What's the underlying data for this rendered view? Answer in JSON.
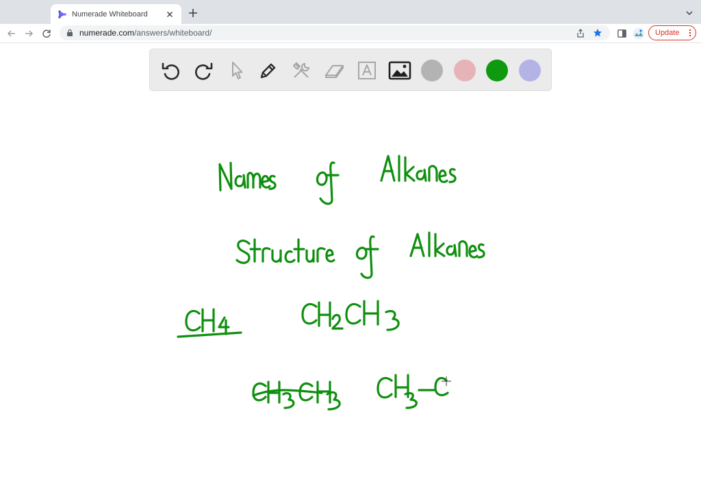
{
  "browser": {
    "tab_title": "Numerade Whiteboard",
    "url_host": "numerade.com",
    "url_path": "/answers/whiteboard/",
    "update_label": "Update"
  },
  "toolbar": {
    "tools": [
      "undo-icon",
      "redo-icon",
      "pointer-icon",
      "pen-icon",
      "tools-icon",
      "eraser-icon",
      "text-icon",
      "image-icon"
    ],
    "colors": [
      "#b3b3b3",
      "#e6b3b8",
      "#0f990f",
      "#b3b3e6"
    ],
    "selected_color": "#0f990f"
  },
  "whiteboard": {
    "ink_color": "#0f8f0f",
    "handwriting": [
      "Names of Alkanes",
      "Structure of Alkanes",
      "CH4",
      "CH2CH3",
      "CH3CH3",
      "CH3-C"
    ]
  }
}
